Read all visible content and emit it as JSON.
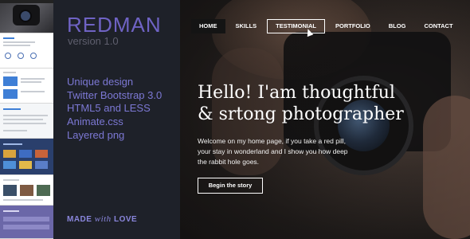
{
  "brand": {
    "name": "REDMAN",
    "version": "version 1.0"
  },
  "features": [
    "Unique design",
    "Twitter Bootstrap 3.0",
    "HTML5 and LESS",
    "Animate.css",
    "Layered png"
  ],
  "made_with": {
    "pre": "MADE ",
    "with": "with",
    "post": " LOVE"
  },
  "nav": {
    "items": [
      {
        "label": "HOME",
        "state": "active"
      },
      {
        "label": "SKILLS",
        "state": "normal"
      },
      {
        "label": "TESTIMONIAL",
        "state": "hover"
      },
      {
        "label": "PORTFOLIO",
        "state": "normal"
      },
      {
        "label": "BLOG",
        "state": "normal"
      },
      {
        "label": "CONTACT",
        "state": "normal"
      }
    ]
  },
  "hero": {
    "headline_line1": "Hello! I'am thoughtful",
    "headline_line2": "& srtong photographer",
    "subtext": "Welcome on my home page, if you take a red pill, your stay in wonderland and I show you how deep the rabbit hole goes.",
    "cta_label": "Begin the story"
  },
  "colors": {
    "accent": "#6f63c4",
    "panel_bg": "#1e2129",
    "nav_active_bg": "#141414"
  }
}
